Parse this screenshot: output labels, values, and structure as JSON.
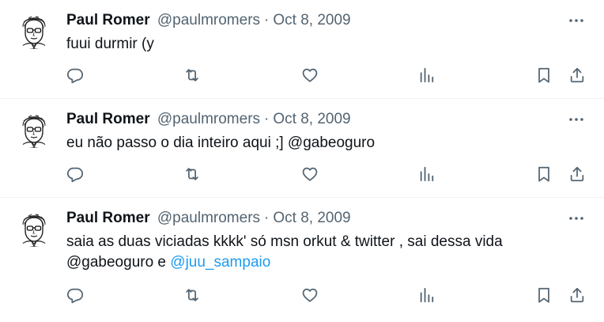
{
  "tweets": [
    {
      "name": "Paul Romer",
      "handle": "@paulmromers",
      "separator": "·",
      "date": "Oct 8, 2009",
      "text": "fuui durmir (y"
    },
    {
      "name": "Paul Romer",
      "handle": "@paulmromers",
      "separator": "·",
      "date": "Oct 8, 2009",
      "text": "eu não passo o dia inteiro aqui ;] @gabeoguro"
    },
    {
      "name": "Paul Romer",
      "handle": "@paulmromers",
      "separator": "·",
      "date": "Oct 8, 2009",
      "text_line1": "saia as duas viciadas kkkk' só msn orkut & twitter , sai dessa vida",
      "text_line2_prefix": "@gabeoguro e ",
      "mention_link": "@juu_sampaio"
    }
  ],
  "icons": {
    "more": "more-horizontal-icon",
    "reply": "reply-icon",
    "retweet": "retweet-icon",
    "like": "heart-icon",
    "views": "views-chart-icon",
    "bookmark": "bookmark-icon",
    "share": "share-icon"
  },
  "colors": {
    "text": "#0f1419",
    "secondary": "#536471",
    "link": "#1d9bf0",
    "divider": "#eff3f4"
  }
}
